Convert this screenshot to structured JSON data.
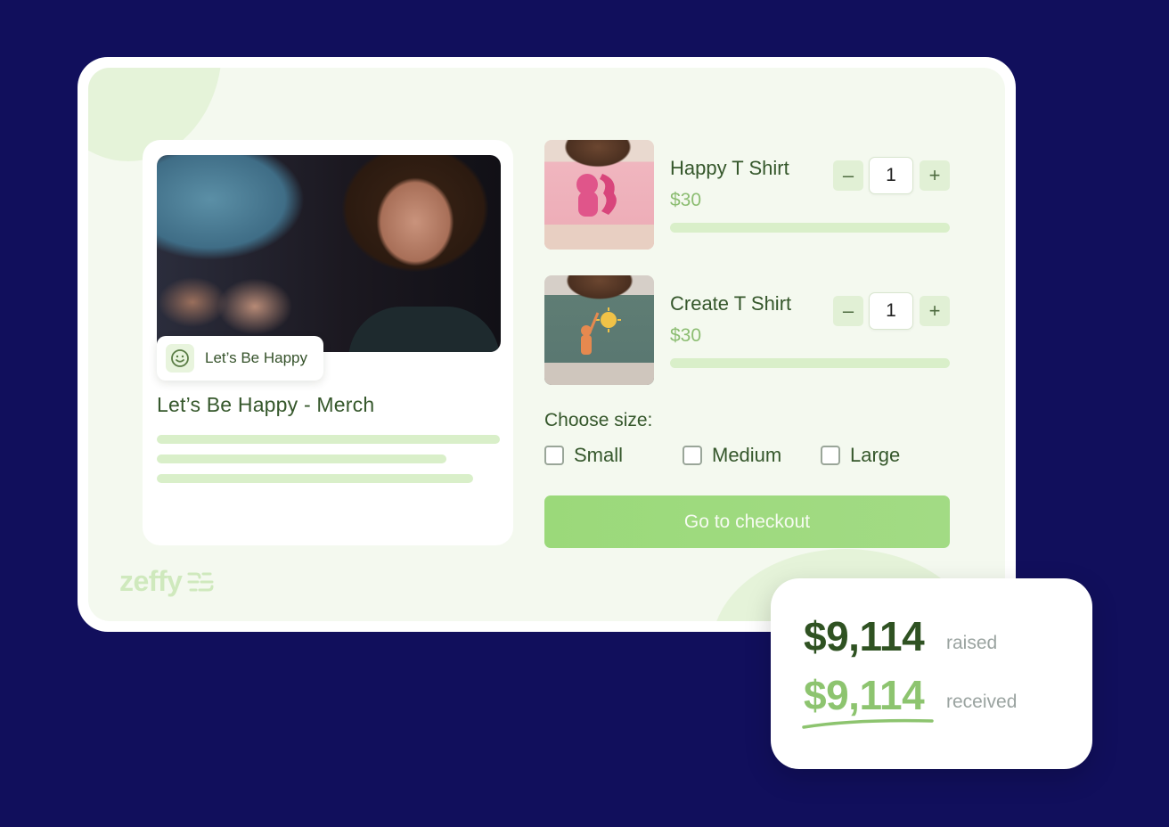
{
  "campaign": {
    "tag_label": "Let’s Be Happy",
    "title": "Let’s Be Happy - Merch",
    "tag_icon": "smiley-icon"
  },
  "products": [
    {
      "name": "Happy T Shirt",
      "price": "$30",
      "quantity": "1",
      "minus_label": "–",
      "plus_label": "+"
    },
    {
      "name": "Create T Shirt",
      "price": "$30",
      "quantity": "1",
      "minus_label": "–",
      "plus_label": "+"
    }
  ],
  "size": {
    "label": "Choose size:",
    "options": [
      "Small",
      "Medium",
      "Large"
    ]
  },
  "checkout": {
    "label": "Go to checkout"
  },
  "brand": {
    "name": "zeffy"
  },
  "stats": {
    "raised_amount": "$9,114",
    "raised_label": "raised",
    "received_amount": "$9,114",
    "received_label": "received"
  },
  "colors": {
    "page_background": "#110f5c",
    "accent_green": "#a2db84",
    "text_green": "#35572b",
    "price_green": "#8cbd72"
  }
}
